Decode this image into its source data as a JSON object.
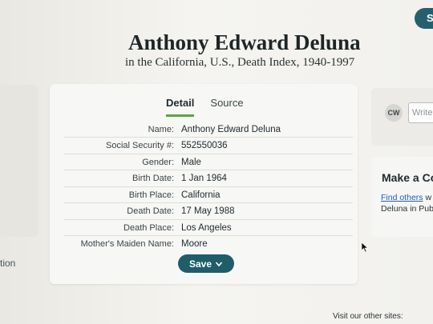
{
  "header": {
    "title": "Anthony Edward Deluna",
    "subtitle": "in the California, U.S., Death Index, 1940-1997",
    "top_right_button": "S"
  },
  "left": {
    "label": "tion"
  },
  "tabs": [
    {
      "label": "Detail",
      "active": true
    },
    {
      "label": "Source",
      "active": false
    }
  ],
  "fields": [
    {
      "label": "Name:",
      "value": "Anthony Edward Deluna"
    },
    {
      "label": "Social Security #:",
      "value": "552550036"
    },
    {
      "label": "Gender:",
      "value": "Male"
    },
    {
      "label": "Birth Date:",
      "value": "1 Jan 1964"
    },
    {
      "label": "Birth Place:",
      "value": "California"
    },
    {
      "label": "Death Date:",
      "value": "17 May 1988"
    },
    {
      "label": "Death Place:",
      "value": "Los Angeles"
    },
    {
      "label": "Mother's Maiden Name:",
      "value": "Moore"
    }
  ],
  "save_button": {
    "label": "Save",
    "icon": "chevron-down-icon"
  },
  "comment": {
    "avatar_initials": "CW",
    "placeholder": "Write"
  },
  "connect": {
    "title": "Make a Co",
    "link_text": "Find others",
    "text_after_link": " w",
    "line2": "Deluna in Pub"
  },
  "footer": {
    "text": "Visit our other sites:"
  },
  "colors": {
    "accent_green": "#5fa340",
    "button_teal": "#1f5d6b",
    "link_blue": "#2560a8"
  }
}
